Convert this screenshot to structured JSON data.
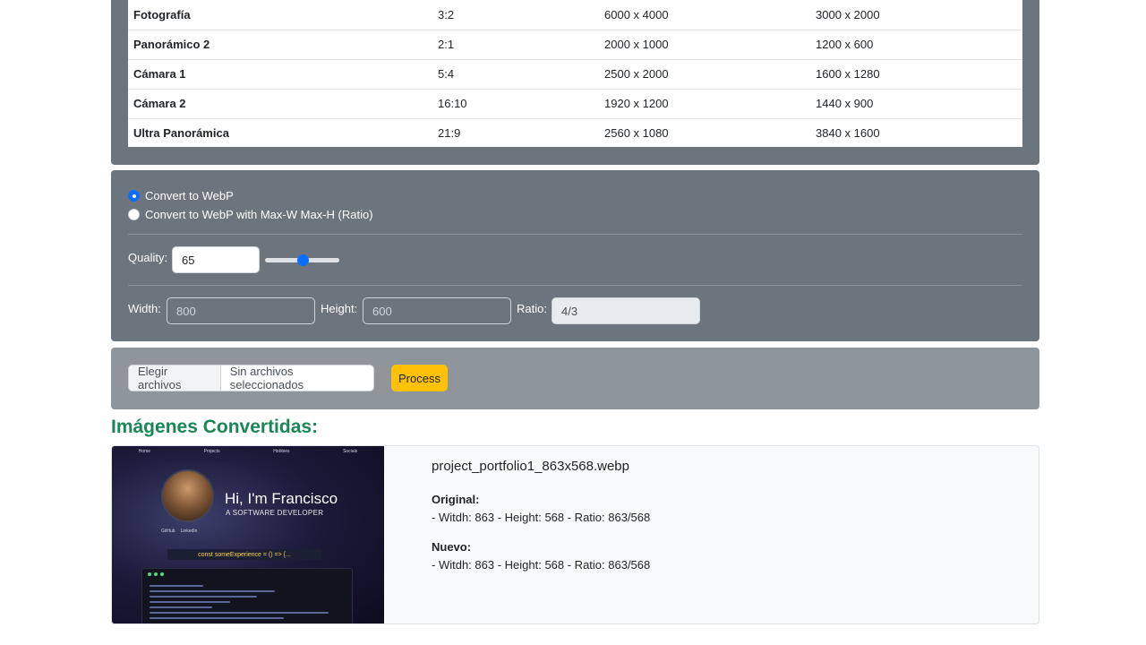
{
  "table": {
    "rows": [
      [
        "Fotografía",
        "3:2",
        "6000 x 4000",
        "3000 x 2000"
      ],
      [
        "Panorámico 2",
        "2:1",
        "2000 x 1000",
        "1200 x 600"
      ],
      [
        "Cámara 1",
        "5:4",
        "2500 x 2000",
        "1600 x 1280"
      ],
      [
        "Cámara 2",
        "16:10",
        "1920 x 1200",
        "1440 x 900"
      ],
      [
        "Ultra Panorámica",
        "21:9",
        "2560 x 1080",
        "3840 x 1600"
      ]
    ]
  },
  "options": {
    "radio1_label": "Convert to WebP",
    "radio2_label": "Convert to WebP with Max-W Max-H (Ratio)",
    "selected": 1,
    "quality_label": "Quality:",
    "quality_value": "65",
    "quality_level": 0.5,
    "width_label": "Width:",
    "width_value": "800",
    "height_label": "Height:",
    "height_value": "600",
    "ratio_label": "Ratio:",
    "ratio_value": "4/3"
  },
  "upload": {
    "choose_label": "Elegir archivos",
    "no_file_label": "Sin archivos seleccionados",
    "process_label": "Process"
  },
  "section_title": "Imágenes Convertidas:",
  "results": [
    {
      "filename": "project_portfolio1_863x568.webp",
      "original_label": "Original:",
      "original_text": "- Witdh: 863 - Height: 568 - Ratio: 863/568",
      "new_label": "Nuevo:",
      "new_text": "- Witdh: 863 - Height: 568 - Ratio: 863/568",
      "thumbnail": {
        "nav": [
          "Home",
          "Projects",
          "Hobbies",
          "Socials"
        ],
        "greeting": "Hi, I'm Francisco",
        "subtitle": "A SOFTWARE DEVELOPER",
        "links": [
          "GitHub",
          "LinkedIn"
        ],
        "code_title": "const someExperience = () => {..."
      }
    }
  ],
  "colors": {
    "panel": "#6c757d",
    "upload_panel": "#8f969b",
    "accent": "#0d6efd",
    "process": "#ffc107",
    "title": "#198754"
  }
}
